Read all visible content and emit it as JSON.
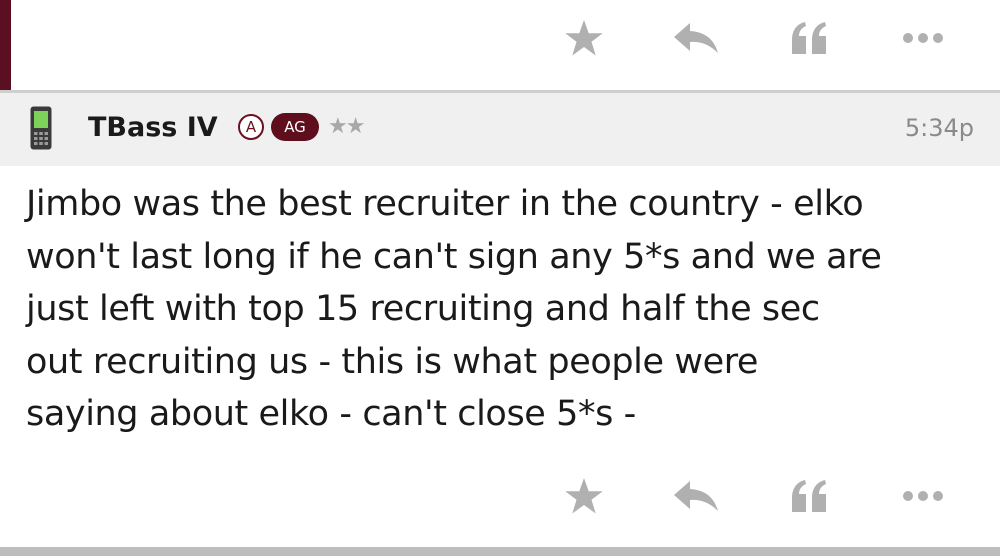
{
  "colors": {
    "accent": "#5a1020",
    "icon_gray": "#b0b0b0",
    "header_background": "#f0f0f0",
    "badge_maroon": "#5e0e1c"
  },
  "previous_post_actions": {
    "star_icon": "star-icon",
    "reply_icon": "reply-icon",
    "quote_icon": "quote-icon",
    "more_icon": "more-icon"
  },
  "post": {
    "device_icon": "phone-icon",
    "username": "TBass IV",
    "badge_a": "A",
    "badge_ag": "AG",
    "rank_stars": "★★",
    "timestamp": "5:34p",
    "body_lines": [
      "Jimbo was the best recruiter in the country - elko",
      "won't last long if he can't sign any 5*s and we are",
      "just left with top 15 recruiting and half the sec",
      "out recruiting us - this is what people were",
      "saying about elko - can't close 5*s -"
    ]
  },
  "post_actions": {
    "star_icon": "star-icon",
    "reply_icon": "reply-icon",
    "quote_icon": "quote-icon",
    "more_icon": "more-icon"
  }
}
